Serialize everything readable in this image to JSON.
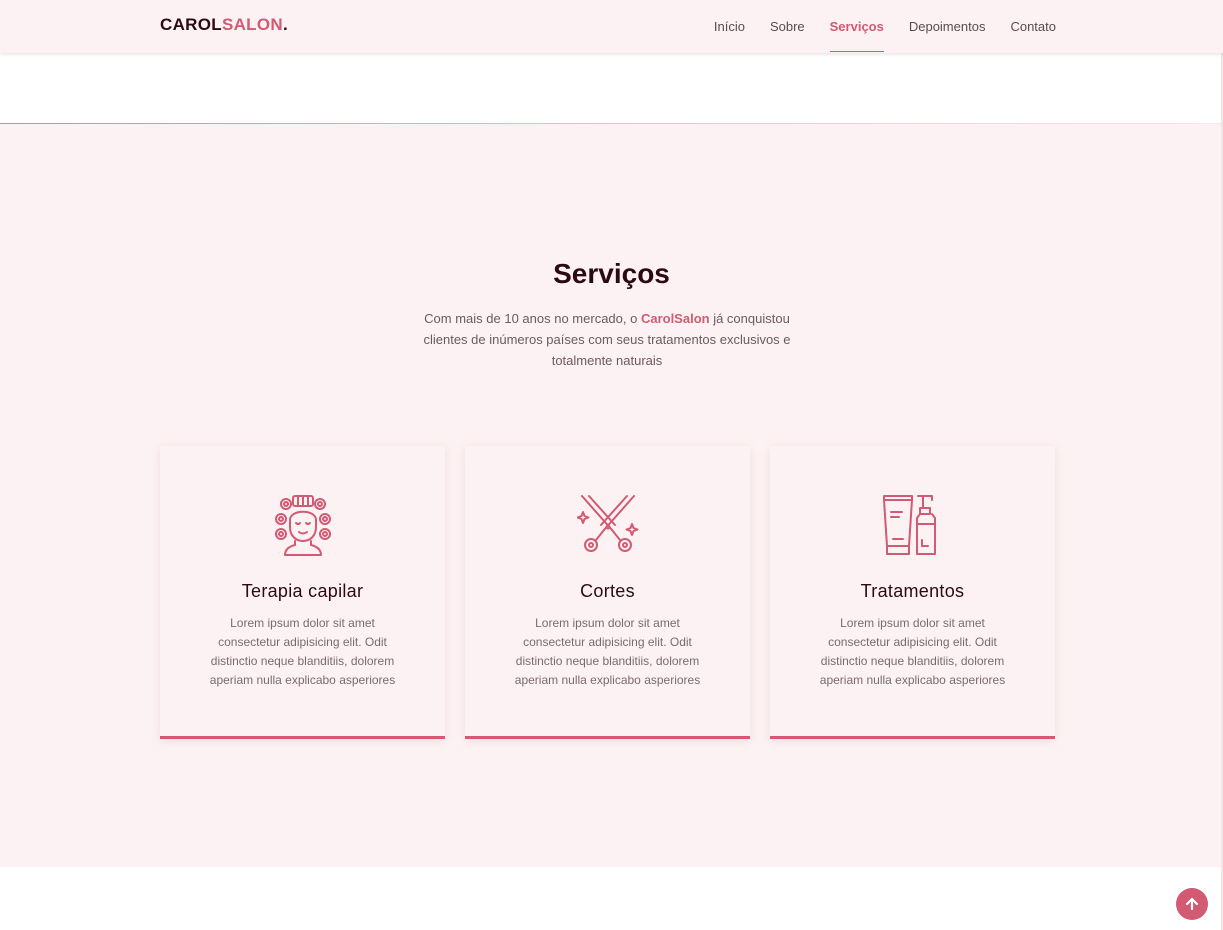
{
  "brand": {
    "logo_primary": "CAROL",
    "logo_accent": "SALON",
    "logo_dot": "."
  },
  "nav": {
    "items": [
      {
        "label": "Início",
        "active": false
      },
      {
        "label": "Sobre",
        "active": false
      },
      {
        "label": "Serviços",
        "active": true
      },
      {
        "label": "Depoimentos",
        "active": false
      },
      {
        "label": "Contato",
        "active": false
      }
    ]
  },
  "services": {
    "title": "Serviços",
    "desc_before": "Com mais de 10 anos no mercado, o ",
    "desc_brand": "CarolSalon",
    "desc_after": " já conquistou clientes de inúmeros países com seus tratamentos exclusivos e totalmente naturais",
    "cards": [
      {
        "icon": "hair-curlers-icon",
        "title": "Terapia capilar",
        "text": "Lorem ipsum dolor sit amet consectetur adipisicing elit. Odit distinctio neque blanditiis, dolorem aperiam nulla explicabo asperiores"
      },
      {
        "icon": "scissors-icon",
        "title": "Cortes",
        "text": "Lorem ipsum dolor sit amet consectetur adipisicing elit. Odit distinctio neque blanditiis, dolorem aperiam nulla explicabo asperiores"
      },
      {
        "icon": "cosmetic-bottles-icon",
        "title": "Tratamentos",
        "text": "Lorem ipsum dolor sit amet consectetur adipisicing elit. Odit distinctio neque blanditiis, dolorem aperiam nulla explicabo asperiores"
      }
    ]
  },
  "scroll_top": {
    "icon": "arrow-up-icon"
  },
  "colors": {
    "accent": "#d25a72",
    "dark_text": "#2b0a14",
    "section_bg": "#fdf2f3"
  }
}
